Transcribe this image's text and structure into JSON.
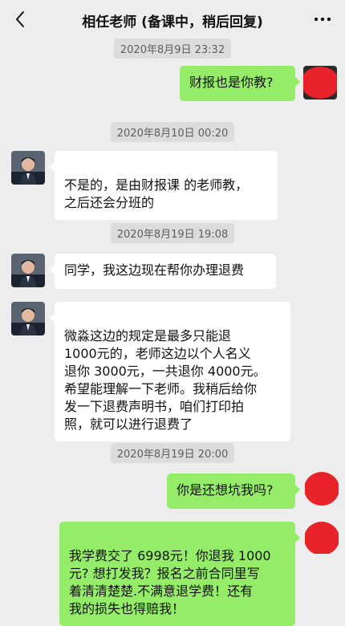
{
  "header": {
    "back_icon": "back-chevron-icon",
    "title": "相任老师 (备课中，稍后回复)",
    "more_icon": "more-dots-icon"
  },
  "messages": [
    {
      "type": "timestamp",
      "text": "2020年8月9日 23:32"
    },
    {
      "type": "outgoing",
      "text": "财报也是你教?"
    },
    {
      "type": "timestamp",
      "text": "2020年8月10日 00:20"
    },
    {
      "type": "incoming",
      "text": "不是的，是由财报课 的老师教，\n之后还会分班的"
    },
    {
      "type": "timestamp",
      "text": "2020年8月19日 19:08"
    },
    {
      "type": "incoming",
      "text": "同学，我这边现在帮你办理退费"
    },
    {
      "type": "incoming",
      "text": "微淼这边的规定是最多只能退\n1000元的，老师这边以个人名义\n退你 3000元，一共退你 4000元。\n希望能理解一下老师。我稍后给你\n发一下退费声明书，咱们打印拍\n照，就可以进行退费了"
    },
    {
      "type": "timestamp",
      "text": "2020年8月19日 20:00"
    },
    {
      "type": "outgoing",
      "text": "你是还想坑我吗?"
    },
    {
      "type": "outgoing",
      "text": "我学费交了 6998元！你退我 1000\n元? 想打发我？报名之前合同里写\n着清清楚楚.不满意退学费！还有\n我的损失也得赔我！"
    }
  ],
  "colors": {
    "background": "#ededed",
    "incoming_bubble": "#ffffff",
    "outgoing_bubble": "#95ec69",
    "redaction": "#e8222a"
  }
}
